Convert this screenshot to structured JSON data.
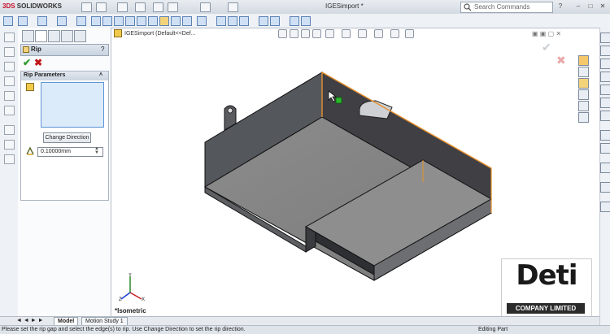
{
  "app": {
    "brand": "SOLIDWORKS",
    "brand_prefix": "3DS",
    "document_title": "IGESimport *"
  },
  "search": {
    "placeholder": "Search Commands"
  },
  "feature_manager": {
    "title": "Rip",
    "rollout_title": "Rip Parameters",
    "change_direction_label": "Change Direction",
    "gap_value": "0.10000mm"
  },
  "breadcrumb": "IGESimport  (Default<<Def...",
  "view_label": "*Isometric",
  "bottom_tabs": [
    "Model",
    "Motion Study 1"
  ],
  "status": {
    "message": "Please set the rip gap and select the edge(s) to rip. Use Change Direction to set the rip direction.",
    "mode": "Editing Part"
  },
  "watermark": {
    "word": "Deti",
    "company": "COMPANY LIMITED"
  },
  "colors": {
    "accent": "#c8102e",
    "selection": "#dcebf9",
    "model_body": "#7b7b7b",
    "highlight_edge": "#e8912e"
  },
  "icons": [
    "solidworks-logo-icon",
    "new-icon",
    "open-icon",
    "save-icon",
    "print-icon",
    "undo-icon",
    "redo-icon",
    "rebuild-icon",
    "options-icon",
    "search-icon",
    "help-icon",
    "minimize-icon",
    "maximize-icon",
    "close-icon",
    "ok-check-icon",
    "cancel-x-icon",
    "zoom-fit-icon",
    "zoom-area-icon",
    "section-view-icon",
    "view-orientation-icon",
    "display-style-icon",
    "hide-show-icon",
    "appearance-icon",
    "scene-icon",
    "triad-icon"
  ]
}
